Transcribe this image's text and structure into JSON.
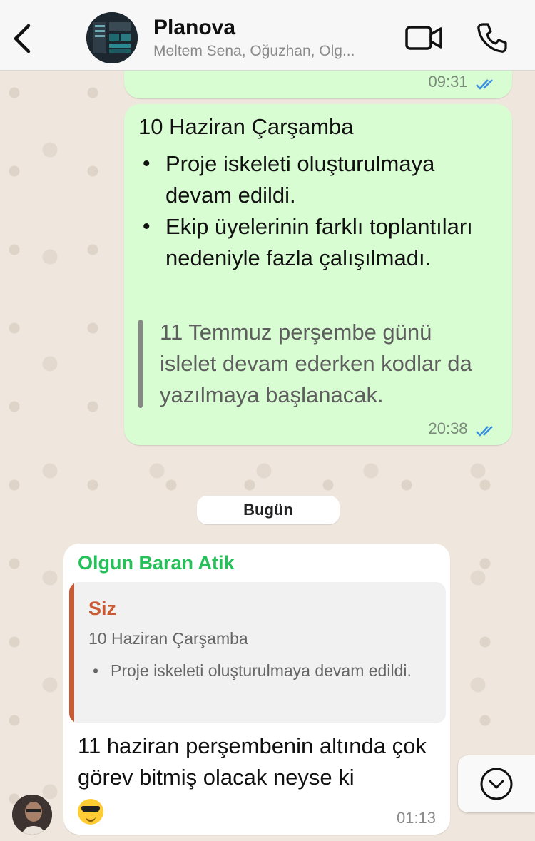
{
  "header": {
    "back_icon": "chevron-left-icon",
    "title": "Planova",
    "subtitle": "Meltem Sena, Oğuzhan, Olg...",
    "video_icon": "video-camera-icon",
    "call_icon": "phone-icon"
  },
  "messages": {
    "prev_time": "09:31",
    "out": {
      "date_line": "10 Haziran Çarşamba",
      "bullets": [
        "Proje iskeleti oluşturulmaya devam edildi.",
        "Ekip üyelerinin farklı toplantıları nedeniyle fazla çalışılmadı."
      ],
      "quote": "11 Temmuz perşembe günü islelet devam ederken kodlar da yazılmaya başlanacak.",
      "time": "20:38"
    },
    "date_separator": "Bugün",
    "in": {
      "sender": "Olgun Baran Atik",
      "reply_sender": "Siz",
      "reply_title": "10 Haziran Çarşamba",
      "reply_bullet": "Proje iskeleti oluşturulmaya devam edildi.",
      "text": "11 haziran perşembenin altında çok görev bitmiş olacak neyse ki",
      "emoji_icon": "smiling-face-with-sunglasses-icon",
      "time": "01:13"
    }
  },
  "colors": {
    "outgoing_bubble": "#d9fdd3",
    "incoming_bubble": "#ffffff",
    "sender_name": "#25c05a",
    "reply_accent": "#c95a33",
    "read_ticks": "#3b8fe0"
  }
}
